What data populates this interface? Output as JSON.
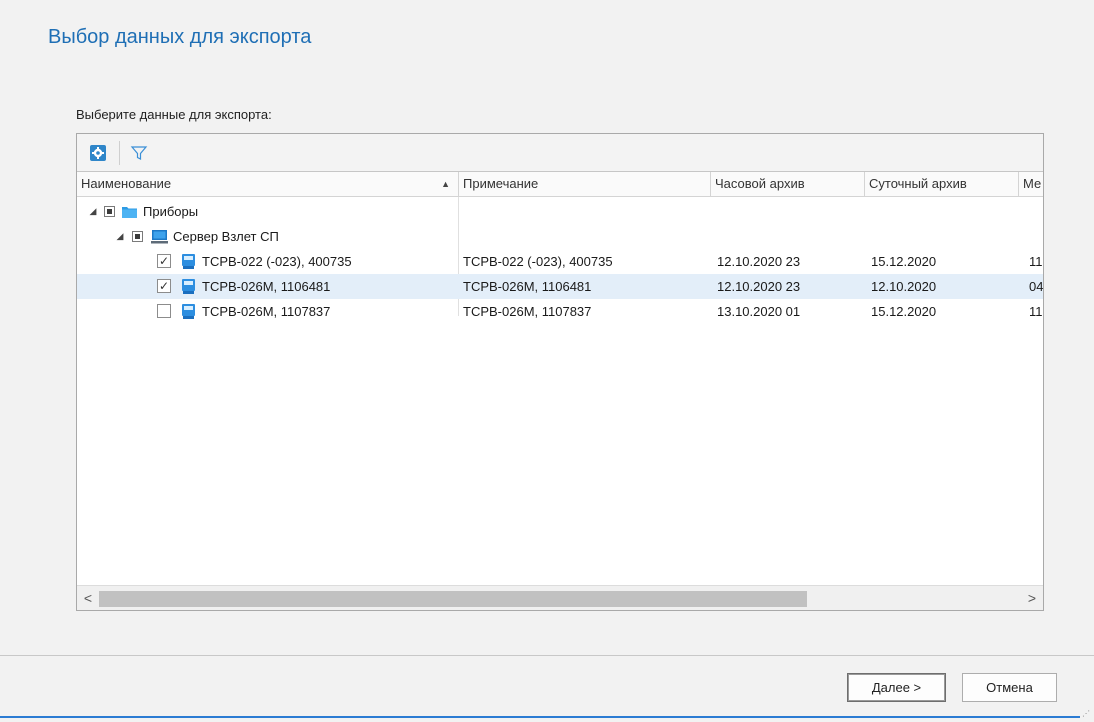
{
  "page": {
    "title": "Выбор данных для экспорта",
    "section_label": "Выберите данные для экспорта:"
  },
  "toolbar": {
    "settings_icon": "gear-icon",
    "filter_icon": "filter-icon"
  },
  "columns": [
    "Наименование",
    "Примечание",
    "Часовой архив",
    "Суточный архив",
    "Ме"
  ],
  "tree": {
    "root": {
      "label": "Приборы",
      "icon": "folder-icon",
      "state": "partial",
      "expanded": true
    },
    "server": {
      "label": "Сервер Взлет СП",
      "icon": "computer-icon",
      "state": "partial",
      "expanded": true
    },
    "devices": [
      {
        "name": "ТСРВ-022 (-023), 400735",
        "note": "ТСРВ-022 (-023), 400735",
        "hourly": "12.10.2020 23",
        "daily": "15.12.2020",
        "more": "11",
        "checked": true,
        "selected": false
      },
      {
        "name": "ТСРВ-026М, 1106481",
        "note": "ТСРВ-026М, 1106481",
        "hourly": "12.10.2020 23",
        "daily": "12.10.2020",
        "more": "04",
        "checked": true,
        "selected": true
      },
      {
        "name": "ТСРВ-026М, 1107837",
        "note": "ТСРВ-026М, 1107837",
        "hourly": "13.10.2020 01",
        "daily": "15.12.2020",
        "more": "11",
        "checked": false,
        "selected": false
      }
    ]
  },
  "scrollbar": {
    "left_arrow": "<",
    "right_arrow": ">"
  },
  "buttons": {
    "next": "Далее >",
    "cancel": "Отмена"
  },
  "colors": {
    "accent": "#1f6fb5",
    "selection": "#e3eef9",
    "bottom_bar": "#2b7cd3"
  }
}
